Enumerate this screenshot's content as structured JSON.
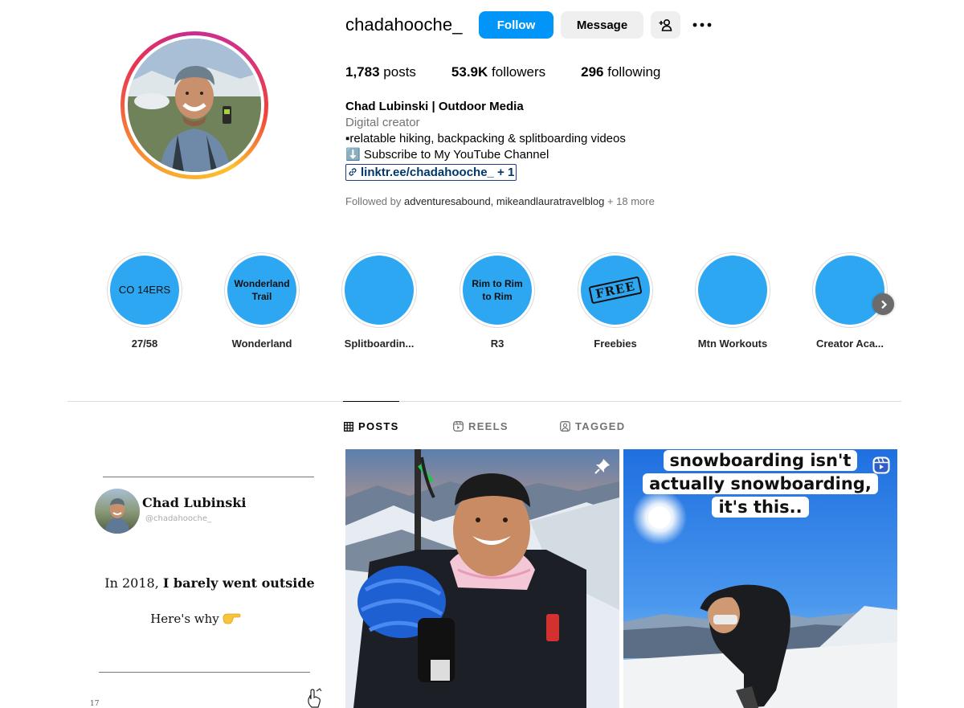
{
  "profile": {
    "username": "chadahooche_",
    "follow_label": "Follow",
    "message_label": "Message",
    "more_label": "•••",
    "stats": {
      "posts_count": "1,783",
      "posts_label": "posts",
      "followers_count": "53.9K",
      "followers_label": "followers",
      "following_count": "296",
      "following_label": "following"
    },
    "bio": {
      "name": "Chad Lubinski | Outdoor Media",
      "category": "Digital creator",
      "line1": "▪relatable hiking, backpacking & splitboarding videos",
      "line2": "⬇️ Subscribe to My YouTube Channel",
      "link": "linktr.ee/chadahooche_ + 1"
    },
    "followed_by": {
      "prefix": "Followed by ",
      "users": "adventuresabound, mikeandlauratravelblog",
      "suffix": " + 18 more"
    }
  },
  "highlights": [
    {
      "cover": "CO 14ERS",
      "label": "27/58"
    },
    {
      "cover": "Wonderland Trail",
      "label": "Wonderland"
    },
    {
      "cover": "",
      "label": "Splitboardin..."
    },
    {
      "cover": "Rim to Rim to Rim",
      "label": "R3"
    },
    {
      "cover": "FREE",
      "label": "Freebies"
    },
    {
      "cover": "",
      "label": "Mtn Workouts"
    },
    {
      "cover": "",
      "label": "Creator Aca..."
    }
  ],
  "tabs": [
    {
      "label": "POSTS",
      "icon": "grid-icon",
      "active": true
    },
    {
      "label": "REELS",
      "icon": "reels-icon",
      "active": false
    },
    {
      "label": "TAGGED",
      "icon": "tagged-icon",
      "active": false
    }
  ],
  "posts": {
    "card": {
      "name": "Chad Lubinski",
      "handle": "@chadahooche_",
      "line1_prefix": "In 2018, ",
      "line1_bold": "I barely went outside",
      "line2": "Here's why",
      "page": "17"
    },
    "post2_caption": [
      "snowboarding isn't",
      "actually snowboarding,",
      "it's this.."
    ]
  },
  "colors": {
    "accent": "#0095f6",
    "highlight_fill": "#2ea7f2",
    "secondary_text": "#737373",
    "link": "#00376b"
  }
}
